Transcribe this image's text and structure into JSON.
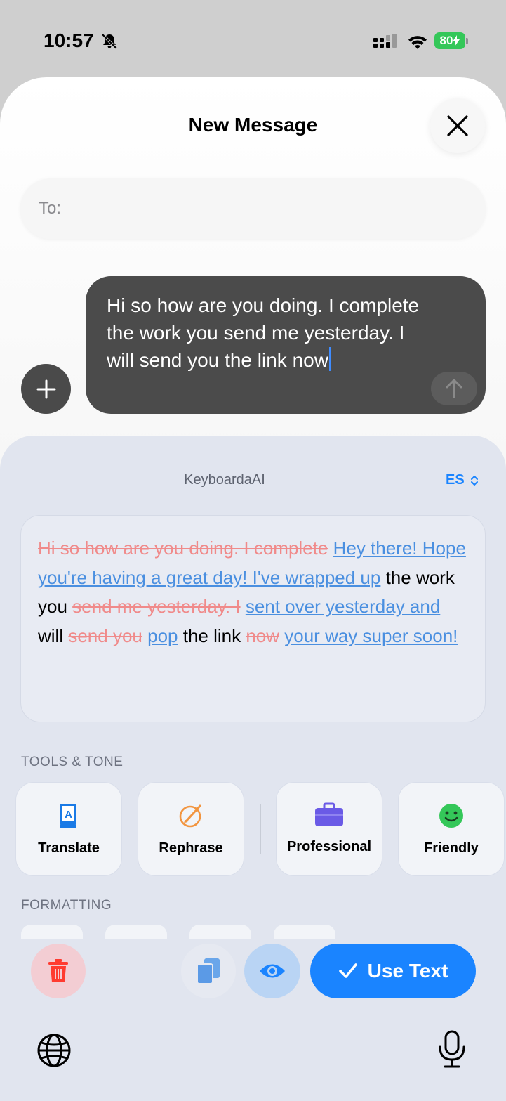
{
  "status_bar": {
    "time": "10:57",
    "battery": "80"
  },
  "sheet": {
    "title": "New Message",
    "to_label": "To:"
  },
  "composer": {
    "text": "Hi so how are you doing. I complete the work you send me yesterday. I will send you the link now"
  },
  "keyboard": {
    "title": "KeyboardaAI",
    "language": "ES",
    "result_segments": [
      {
        "type": "del",
        "text": "Hi so how are you doing. I complete"
      },
      {
        "type": "same",
        "text": " "
      },
      {
        "type": "ins",
        "text": "Hey there! Hope you're having a great day! I've wrapped up"
      },
      {
        "type": "same",
        "text": " the work you "
      },
      {
        "type": "del",
        "text": "send me yesterday. I"
      },
      {
        "type": "same",
        "text": " "
      },
      {
        "type": "ins",
        "text": "sent over yesterday and"
      },
      {
        "type": "same",
        "text": " will "
      },
      {
        "type": "del",
        "text": "send you"
      },
      {
        "type": "same",
        "text": " "
      },
      {
        "type": "ins",
        "text": "pop"
      },
      {
        "type": "same",
        "text": " the link "
      },
      {
        "type": "del",
        "text": "now"
      },
      {
        "type": "same",
        "text": " "
      },
      {
        "type": "ins",
        "text": "your way super soon!"
      }
    ],
    "tools_label": "TOOLS & TONE",
    "tools": [
      {
        "label": "Translate",
        "icon": "translate-book-icon"
      },
      {
        "label": "Rephrase",
        "icon": "rephrase-pencil-icon"
      },
      {
        "label": "Professional",
        "icon": "briefcase-icon"
      },
      {
        "label": "Friendly",
        "icon": "smiley-icon"
      }
    ],
    "formatting_label": "FORMATTING",
    "use_text_label": "Use Text"
  },
  "colors": {
    "accent": "#1a84ff",
    "deleted": "#f08a8a",
    "inserted": "#4a8fe0",
    "panel": "#e1e5ef"
  }
}
